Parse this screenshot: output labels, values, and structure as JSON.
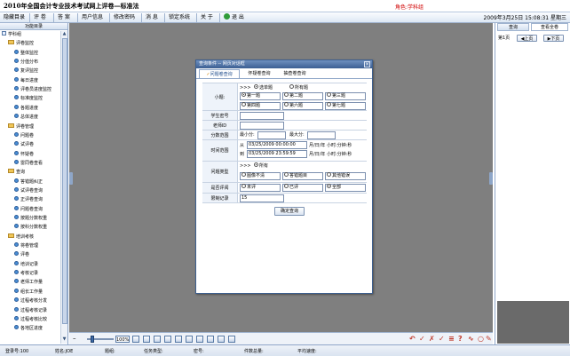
{
  "app": {
    "title": "2010年全国会计专业技术考试网上评卷—标准法",
    "role": "角色:学科组",
    "datetime": "2009年3月25日 15:08:31 星期三"
  },
  "menu": [
    {
      "label": "隐藏目录"
    },
    {
      "label": "评 卷"
    },
    {
      "label": "答 案"
    },
    {
      "label": "用户信息"
    },
    {
      "label": "修改密码"
    },
    {
      "label": "消 息"
    },
    {
      "label": "锁定系统"
    },
    {
      "label": "关 于"
    },
    {
      "label": "退 出"
    }
  ],
  "left_panel": {
    "header": "功能目录",
    "tree": [
      {
        "label": "学科组",
        "level": 0,
        "icon": "root"
      },
      {
        "label": "评卷监控",
        "level": 1,
        "icon": "folder"
      },
      {
        "label": "整体监控",
        "level": 2,
        "icon": "doc"
      },
      {
        "label": "分值分布",
        "level": 2,
        "icon": "doc"
      },
      {
        "label": "复评监控",
        "level": 2,
        "icon": "doc"
      },
      {
        "label": "每日进度",
        "level": 2,
        "icon": "doc"
      },
      {
        "label": "评卷员进度监控",
        "level": 2,
        "icon": "doc"
      },
      {
        "label": "标准度监控",
        "level": 2,
        "icon": "doc"
      },
      {
        "label": "各题进度",
        "level": 2,
        "icon": "doc"
      },
      {
        "label": "总体进度",
        "level": 2,
        "icon": "doc"
      },
      {
        "label": "评卷管理",
        "level": 1,
        "icon": "folder"
      },
      {
        "label": "问题卷",
        "level": 2,
        "icon": "doc"
      },
      {
        "label": "试评卷",
        "level": 2,
        "icon": "doc"
      },
      {
        "label": "怀疑卷",
        "level": 2,
        "icon": "doc"
      },
      {
        "label": "雷同卷查看",
        "level": 2,
        "icon": "doc"
      },
      {
        "label": "查询",
        "level": 1,
        "icon": "folder"
      },
      {
        "label": "答错题纠正",
        "level": 2,
        "icon": "doc"
      },
      {
        "label": "试评卷查询",
        "level": 2,
        "icon": "doc"
      },
      {
        "label": "正评卷查询",
        "level": 2,
        "icon": "doc"
      },
      {
        "label": "问题卷查询",
        "level": 2,
        "icon": "doc"
      },
      {
        "label": "按题分数权重",
        "level": 2,
        "icon": "doc"
      },
      {
        "label": "按科分数权重",
        "level": 2,
        "icon": "doc"
      },
      {
        "label": "培训考核",
        "level": 1,
        "icon": "folder"
      },
      {
        "label": "将卷管理",
        "level": 2,
        "icon": "doc"
      },
      {
        "label": "评卷",
        "level": 2,
        "icon": "doc"
      },
      {
        "label": "培训记录",
        "level": 2,
        "icon": "doc"
      },
      {
        "label": "考核记录",
        "level": 2,
        "icon": "doc"
      },
      {
        "label": "老师工作量",
        "level": 2,
        "icon": "doc"
      },
      {
        "label": "组长工作量",
        "level": 2,
        "icon": "doc"
      },
      {
        "label": "过程考核分发",
        "level": 2,
        "icon": "doc"
      },
      {
        "label": "过程考核记录",
        "level": 2,
        "icon": "doc"
      },
      {
        "label": "过程考核比较",
        "level": 2,
        "icon": "doc"
      },
      {
        "label": "各地区进度",
        "level": 2,
        "icon": "doc"
      }
    ]
  },
  "right_panel": {
    "tabs": [
      "查询",
      "查看全卷"
    ],
    "page_label": "第1页",
    "prev_label": "上页",
    "next_label": "下页"
  },
  "dialog": {
    "title": "查询条件 -- 网页对话框",
    "close": "×",
    "tabs": [
      {
        "label": "问题卷查询",
        "active": true
      },
      {
        "label": "怀疑卷查询",
        "active": false
      },
      {
        "label": "抽查卷查询",
        "active": false
      }
    ],
    "labels": {
      "question": "小题:",
      "student_id": "学生密号",
      "teacher_id": "老师ID",
      "score_range": "分数范围",
      "time_range": "时间范围",
      "problem_type": "问题类型",
      "is_review": "是否评阅",
      "limit": "限制记录"
    },
    "question_mode": {
      "prefix": ">>>",
      "single": "选单题",
      "all": "所有题",
      "selected": "single"
    },
    "questions": [
      {
        "label": "第一题",
        "checked": true
      },
      {
        "label": "第二题",
        "checked": false
      },
      {
        "label": "第三题",
        "checked": false
      },
      {
        "label": "第四题",
        "checked": false
      },
      {
        "label": "第六题",
        "checked": false
      },
      {
        "label": "第七题",
        "checked": false
      }
    ],
    "student_id_value": "",
    "teacher_id_value": "",
    "score_min_label": "最小分:",
    "score_max_label": "最大分:",
    "score_min": "",
    "score_max": "",
    "time_from_label": "从",
    "time_from": "03/25/2009 00:00:00",
    "time_to_label": "到",
    "time_to": "03/25/2009 23:59:59",
    "time_format": "月/日/年 小时:分钟:秒",
    "problem_prefix": ">>>",
    "problem_all": "所有",
    "problem_types": [
      {
        "label": "图像不清",
        "checked": false
      },
      {
        "label": "答错题目",
        "checked": false
      },
      {
        "label": "其他错误",
        "checked": false
      }
    ],
    "review_options": [
      {
        "label": "未评",
        "checked": false
      },
      {
        "label": "已评",
        "checked": false
      },
      {
        "label": "全部",
        "checked": true
      }
    ],
    "limit_value": "15",
    "confirm": "确定查询"
  },
  "toolbar": {
    "zoom_value": "100%"
  },
  "status": {
    "login_count": "登录号:100",
    "name": "姓名:JOE",
    "question": "题组:",
    "task_type": "任务类型:",
    "secret": "密号:",
    "work_total": "件数总量:",
    "avg_speed": "平均速度:"
  }
}
